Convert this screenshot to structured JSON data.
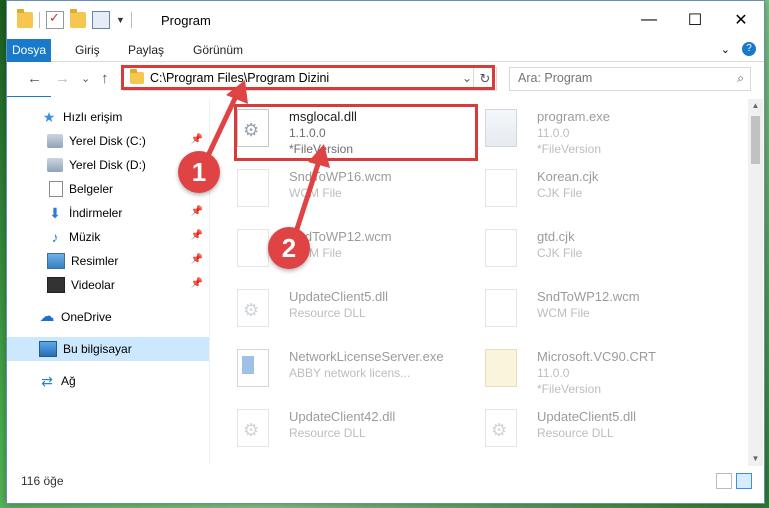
{
  "window": {
    "title": "Program",
    "controls": {
      "minimize": "—",
      "maximize": "☐",
      "close": "✕"
    }
  },
  "ribbon": {
    "tabs": [
      "Dosya",
      "Giriş",
      "Paylaş",
      "Görünüm"
    ],
    "expand_icon": "⌄",
    "help_icon": "?"
  },
  "nav": {
    "back": "←",
    "forward": "→",
    "recent": "⌄",
    "up": "↑",
    "address": "C:\\Program Files\\Program Dizini",
    "address_dropdown": "⌄",
    "refresh": "↻",
    "search_placeholder": "Ara: Program",
    "search_icon": "⌕"
  },
  "sidebar": {
    "items": [
      {
        "label": "Hızlı erişim",
        "icon": "star-icon",
        "glyph": "★"
      },
      {
        "label": "Yerel Disk (C:)",
        "icon": "drive-icon",
        "pinned": true
      },
      {
        "label": "Yerel Disk (D:)",
        "icon": "drive-icon",
        "pinned": true
      },
      {
        "label": "Belgeler",
        "icon": "document-icon",
        "pinned": true
      },
      {
        "label": "İndirmeler",
        "icon": "download-icon",
        "glyph": "⬇",
        "pinned": true
      },
      {
        "label": "Müzik",
        "icon": "music-icon",
        "glyph": "♪",
        "pinned": true
      },
      {
        "label": "Resimler",
        "icon": "pictures-icon",
        "pinned": true
      },
      {
        "label": "Videolar",
        "icon": "video-icon",
        "pinned": true
      },
      {
        "label": "OneDrive",
        "icon": "cloud-icon",
        "glyph": "☁"
      },
      {
        "label": "Bu bilgisayar",
        "icon": "computer-icon",
        "selected": true
      },
      {
        "label": "Ağ",
        "icon": "network-icon",
        "glyph": "⇄"
      }
    ],
    "pin_glyph": "📌"
  },
  "files": [
    {
      "name": "msglocal.dll",
      "line1": "1.1.0.0",
      "line2": "*FileVersion",
      "icon": "dll",
      "highlighted": true
    },
    {
      "name": "program.exe",
      "line1": "11.0.0",
      "line2": "*FileVersion",
      "icon": "exe"
    },
    {
      "name": "SndToWP16.wcm",
      "line1": "WCM File",
      "line2": "",
      "icon": "file"
    },
    {
      "name": "Korean.cjk",
      "line1": "CJK File",
      "line2": "",
      "icon": "file"
    },
    {
      "name": "SndToWP12.wcm",
      "line1": "WCM File",
      "line2": "",
      "icon": "file"
    },
    {
      "name": "gtd.cjk",
      "line1": "CJK File",
      "line2": "",
      "icon": "file"
    },
    {
      "name": "UpdateClient5.dll",
      "line1": "Resource DLL",
      "line2": "",
      "icon": "dll"
    },
    {
      "name": "SndToWP12.wcm",
      "line1": "WCM File",
      "line2": "",
      "icon": "file"
    },
    {
      "name": "NetworkLicenseServer.exe",
      "line1": "ABBY network licens...",
      "line2": "",
      "icon": "exe2"
    },
    {
      "name": "Microsoft.VC90.CRT",
      "line1": "11.0.0",
      "line2": "*FileVersion",
      "icon": "crt"
    },
    {
      "name": "UpdateClient42.dll",
      "line1": "Resource DLL",
      "line2": "",
      "icon": "dll"
    },
    {
      "name": "UpdateClient5.dll",
      "line1": "Resource DLL",
      "line2": "",
      "icon": "dll"
    }
  ],
  "status": {
    "count": "116 öğe"
  },
  "callouts": [
    {
      "number": "1",
      "color": "#e04343"
    },
    {
      "number": "2",
      "color": "#e04343"
    }
  ],
  "colors": {
    "accent": "#1979ca",
    "highlight_border": "#d93a3a",
    "selection": "#cce8ff"
  }
}
